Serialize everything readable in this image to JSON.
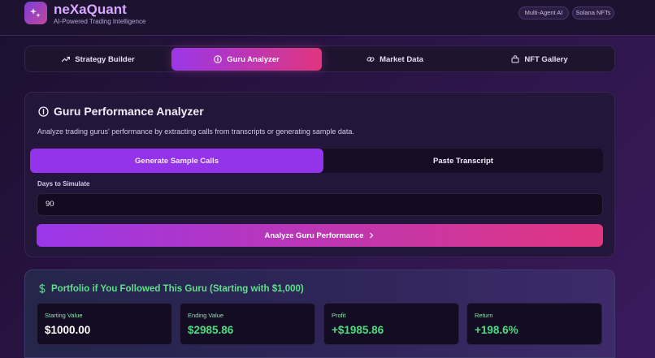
{
  "header": {
    "app_name": "neXaQuant",
    "tagline": "AI-Powered Trading Intelligence",
    "logo_icon": "sparkles-icon",
    "badges": [
      "Multi-Agent AI",
      "Solana NFTs"
    ]
  },
  "tabs": [
    {
      "label": "Strategy Builder",
      "icon": "trend-up-icon"
    },
    {
      "label": "Guru Analyzer",
      "icon": "info-icon",
      "active": true
    },
    {
      "label": "Market Data",
      "icon": "link-icon"
    },
    {
      "label": "NFT Gallery",
      "icon": "shopping-bag-icon"
    }
  ],
  "analyzer": {
    "title": "Guru Performance Analyzer",
    "description": "Analyze trading gurus' performance by extracting calls from transcripts or generating sample data.",
    "modes": [
      {
        "label": "Generate Sample Calls",
        "active": true
      },
      {
        "label": "Paste Transcript",
        "active": false
      }
    ],
    "days_label": "Days to Simulate",
    "days_value": "90",
    "submit_label": "Analyze Guru Performance"
  },
  "portfolio": {
    "title": "Portfolio if You Followed This Guru (Starting with $1,000)",
    "stats": [
      {
        "label": "Starting Value",
        "value": "$1000.00",
        "color": "#ffffff"
      },
      {
        "label": "Ending Value",
        "value": "$2985.86",
        "color": "#4ade80"
      },
      {
        "label": "Profit",
        "value": "+$1985.86",
        "color": "#4ade80"
      },
      {
        "label": "Return",
        "value": "+198.6%",
        "color": "#4ade80"
      }
    ]
  },
  "colors": {
    "accent_purple": "#9333ea",
    "accent_pink": "#e0357f",
    "positive_green": "#4ade80"
  }
}
